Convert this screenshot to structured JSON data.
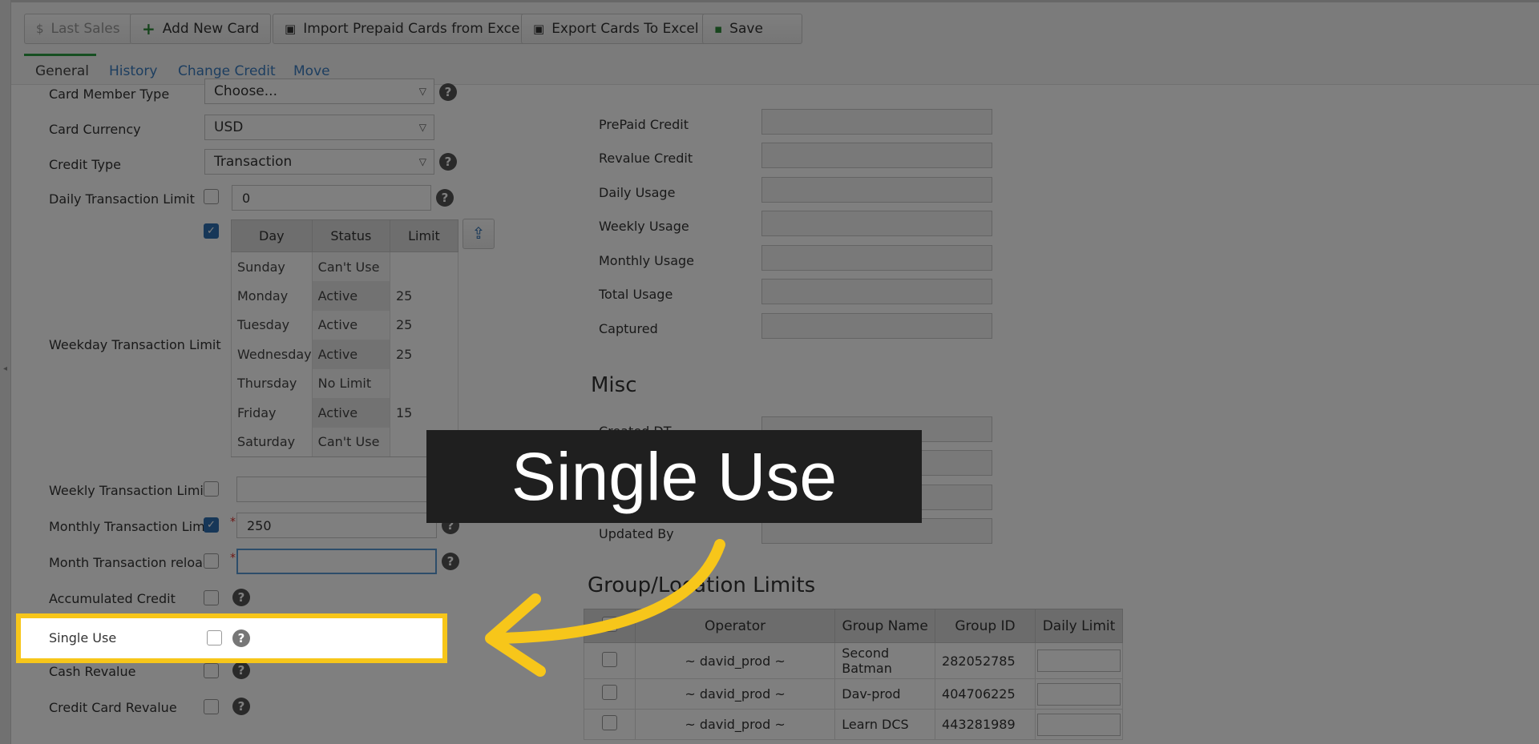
{
  "toolbar": {
    "last_sales": "Last Sales",
    "add_new_card": "Add New Card",
    "import_prepaid": "Import Prepaid Cards from Excel",
    "export_cards": "Export Cards To Excel",
    "save": "Save"
  },
  "tabs": [
    {
      "label": "General",
      "active": true
    },
    {
      "label": "History"
    },
    {
      "label": "Change Credit"
    },
    {
      "label": "Move"
    }
  ],
  "form": {
    "card_member_type": {
      "label": "Card Member Type",
      "value": "Choose..."
    },
    "card_currency": {
      "label": "Card Currency",
      "value": "USD"
    },
    "credit_type": {
      "label": "Credit Type",
      "value": "Transaction"
    },
    "daily_transaction_limit": {
      "label": "Daily Transaction Limit",
      "checked": false,
      "value": "0"
    },
    "weekday_transaction_limit": {
      "label": "Weekday Transaction Limit",
      "checked": true,
      "headers": [
        "Day",
        "Status",
        "Limit"
      ],
      "rows": [
        {
          "day": "Sunday",
          "status": "Can't Use",
          "limit": ""
        },
        {
          "day": "Monday",
          "status": "Active",
          "limit": "25"
        },
        {
          "day": "Tuesday",
          "status": "Active",
          "limit": "25"
        },
        {
          "day": "Wednesday",
          "status": "Active",
          "limit": "25"
        },
        {
          "day": "Thursday",
          "status": "No Limit",
          "limit": ""
        },
        {
          "day": "Friday",
          "status": "Active",
          "limit": "15"
        },
        {
          "day": "Saturday",
          "status": "Can't Use",
          "limit": ""
        }
      ]
    },
    "weekly_transaction_limit": {
      "label": "Weekly Transaction Limit",
      "checked": false,
      "value": ""
    },
    "monthly_transaction_limit": {
      "label": "Monthly Transaction Limit",
      "checked": true,
      "value": "250"
    },
    "month_transaction_reload": {
      "label": "Month Transaction reload",
      "checked": false,
      "value": ""
    },
    "accumulated_credit": {
      "label": "Accumulated Credit",
      "checked": false
    },
    "single_use": {
      "label": "Single Use",
      "checked": false
    },
    "cash_revalue": {
      "label": "Cash Revalue",
      "checked": false
    },
    "credit_card_revalue": {
      "label": "Credit Card Revalue",
      "checked": false
    }
  },
  "credit_details": {
    "fields": [
      "PrePaid Credit",
      "Revalue Credit",
      "Daily Usage",
      "Weekly Usage",
      "Monthly Usage",
      "Total Usage",
      "Captured"
    ]
  },
  "misc": {
    "title": "Misc",
    "fields": [
      "Created DT",
      "",
      "",
      "Updated By"
    ]
  },
  "group_limits": {
    "title": "Group/Location Limits",
    "headers": [
      "",
      "Operator",
      "Group Name",
      "Group ID",
      "Daily Limit"
    ],
    "rows": [
      {
        "operator": "~ david_prod ~",
        "group_name": "Second Batman",
        "group_id": "282052785"
      },
      {
        "operator": "~ david_prod ~",
        "group_name": "Dav-prod",
        "group_id": "404706225"
      },
      {
        "operator": "~ david_prod ~",
        "group_name": "Learn DCS",
        "group_id": "443281989"
      }
    ]
  },
  "callout": {
    "text": "Single Use",
    "highlight_color": "#f7c61a"
  }
}
